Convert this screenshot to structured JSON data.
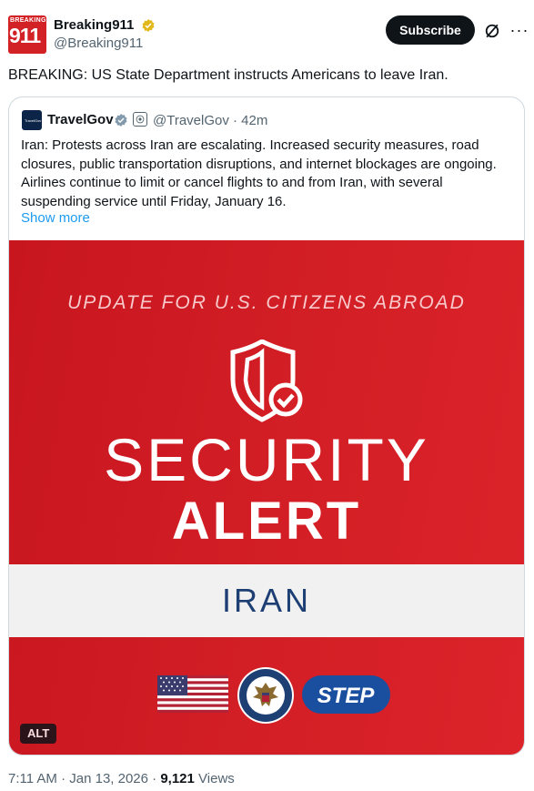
{
  "author": {
    "logo_top": "BREAKING",
    "logo_main": "911",
    "name": "Breaking911",
    "handle": "@Breaking911",
    "verified_icon": "gold-verified-badge"
  },
  "actions": {
    "subscribe_label": "Subscribe",
    "grok_icon": "grok-icon",
    "more_icon": "more-options-icon"
  },
  "tweet": {
    "text": "BREAKING: US State Department instructs Americans to leave Iran."
  },
  "quote": {
    "avatar_text": "TravelGov",
    "name": "TravelGov",
    "handle_time": "@TravelGov · 42m",
    "text": "Iran: Protests across Iran are escalating. Increased security measures, road closures, public transportation disruptions, and internet blockages are ongoing. Airlines continue to limit or cancel flights to and from Iran, with several suspending service until Friday, January 16.",
    "show_more": "Show more"
  },
  "media": {
    "update_line": "UPDATE FOR U.S. CITIZENS ABROAD",
    "security": "SECURITY",
    "alert": "ALERT",
    "country": "IRAN",
    "step_label": "STEP",
    "alt_label": "ALT",
    "colors": {
      "red": "#d41f26",
      "navy": "#1d3f73",
      "band": "#f1f1f1"
    }
  },
  "footer": {
    "time": "7:11 AM · Jan 13, 2026 · ",
    "views_count": "9,121",
    "views_label": " Views"
  }
}
